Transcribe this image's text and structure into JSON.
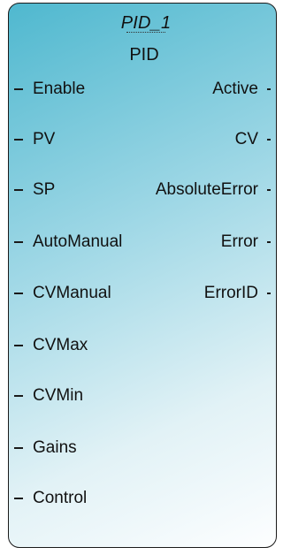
{
  "block": {
    "instance_name": "PID_1",
    "type_name": "PID"
  },
  "inputs": [
    {
      "label": "Enable"
    },
    {
      "label": "PV"
    },
    {
      "label": "SP"
    },
    {
      "label": "AutoManual"
    },
    {
      "label": "CVManual"
    },
    {
      "label": "CVMax"
    },
    {
      "label": "CVMin"
    },
    {
      "label": "Gains"
    },
    {
      "label": "Control"
    }
  ],
  "outputs": [
    {
      "label": "Active"
    },
    {
      "label": "CV"
    },
    {
      "label": "AbsoluteError"
    },
    {
      "label": "Error"
    },
    {
      "label": "ErrorID"
    }
  ],
  "colors": {
    "gradient_start": "#4fb8cf",
    "gradient_end": "#fdfeff",
    "border": "#1a1a1a"
  }
}
